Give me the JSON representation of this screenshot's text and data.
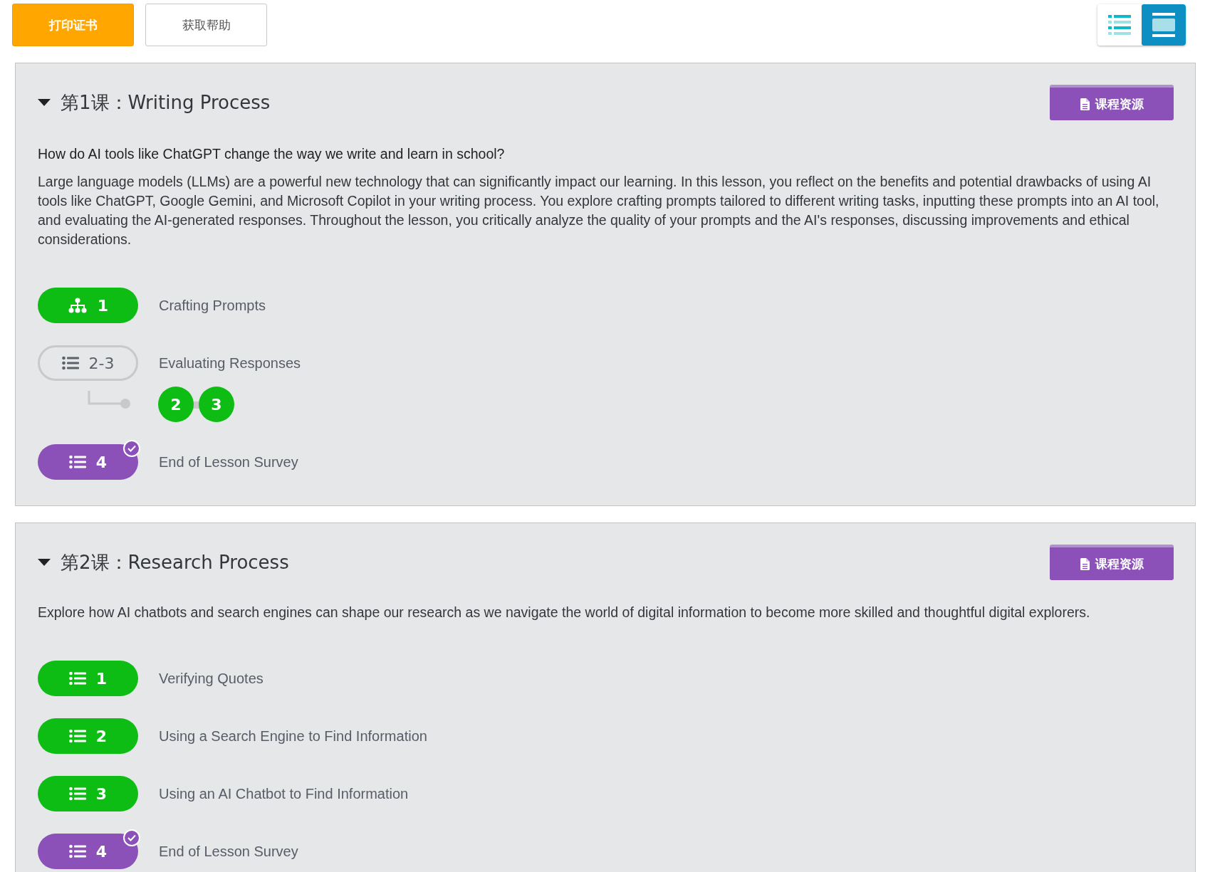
{
  "toolbar": {
    "buttons": [
      {
        "label": "打印证书",
        "kind": "primary"
      },
      {
        "label": "获取帮助",
        "kind": "secondary"
      }
    ],
    "view_toggle": [
      {
        "kind": "list",
        "selected": false
      },
      {
        "kind": "cards",
        "selected": true
      }
    ]
  },
  "lessons": [
    {
      "title": "第1课：Writing Process",
      "expanded": true,
      "resource_button": "课程资源",
      "question": "How do AI tools like ChatGPT change the way we write and learn in school?",
      "description": "Large language models (LLMs) are a powerful new technology that can significantly impact our learning. In this lesson, you reflect on the benefits and potential drawbacks of using AI tools like ChatGPT, Google Gemini, and Microsoft Copilot in your writing process. You explore crafting prompts tailored to different writing tasks, inputting these prompts into an AI tool, and evaluating the AI-generated responses. Throughout the lesson, you critically analyze the quality of your prompts and the AI's responses, discussing improvements and ethical considerations.",
      "activities": [
        {
          "kind": "branching",
          "number": "1",
          "title": "Crafting Prompts",
          "color": "#0dbd14",
          "checked": false
        },
        {
          "kind": "group",
          "number": "2-3",
          "title": "Evaluating Responses",
          "color": "#c8c9cb",
          "checked": false,
          "children": [
            {
              "number": "2",
              "color": "#0dbd14"
            },
            {
              "number": "3",
              "color": "#0dbd14"
            }
          ]
        },
        {
          "kind": "linear",
          "number": "4",
          "title": "End of Lesson Survey",
          "color": "#8b51b8",
          "checked": true
        }
      ]
    },
    {
      "title": "第2课：Research Process",
      "expanded": true,
      "resource_button": "课程资源",
      "description": "Explore how AI chatbots and search engines can shape our research as we navigate the world of digital information to become more skilled and thoughtful digital explorers.",
      "activities": [
        {
          "kind": "linear",
          "number": "1",
          "title": "Verifying Quotes",
          "color": "#0dbd14",
          "checked": false
        },
        {
          "kind": "linear",
          "number": "2",
          "title": "Using a Search Engine to Find Information",
          "color": "#0dbd14",
          "checked": false
        },
        {
          "kind": "linear",
          "number": "3",
          "title": "Using an AI Chatbot to Find Information",
          "color": "#0dbd14",
          "checked": false
        },
        {
          "kind": "linear",
          "number": "4",
          "title": "End of Lesson Survey",
          "color": "#8b51b8",
          "checked": true
        }
      ]
    }
  ]
}
